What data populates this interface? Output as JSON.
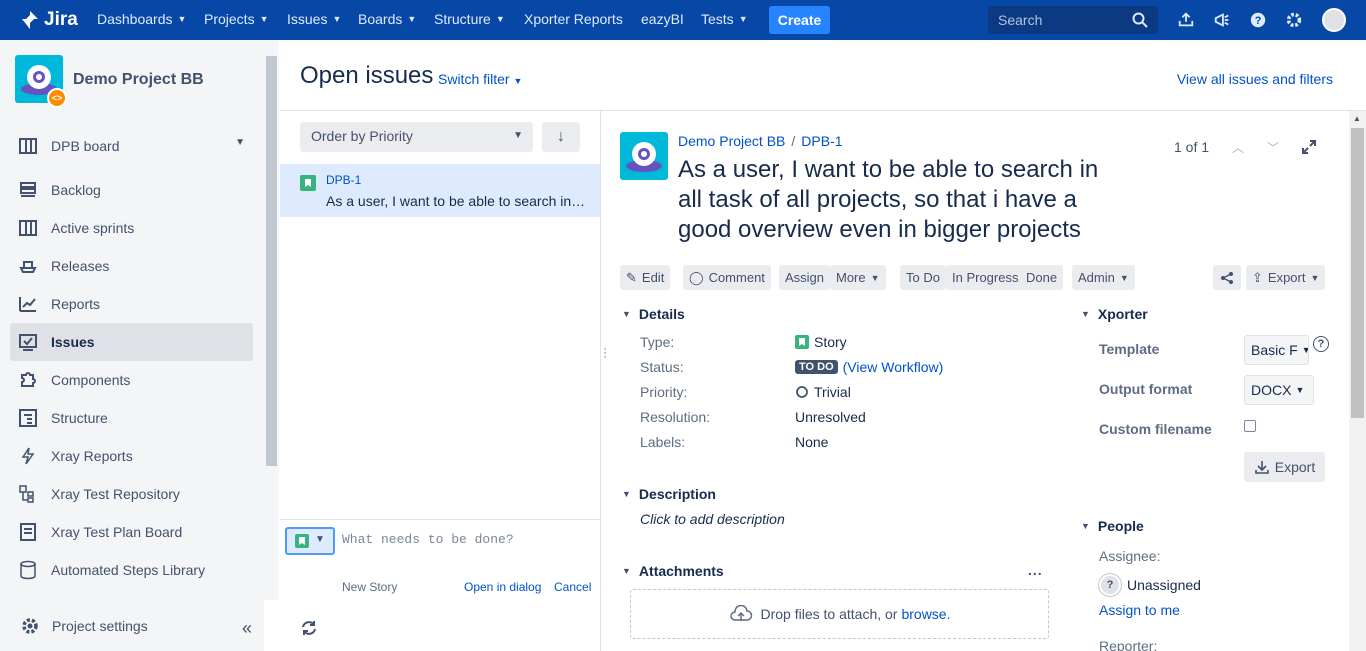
{
  "topnav": {
    "logo": "Jira",
    "items": [
      {
        "label": "Dashboards",
        "caret": true
      },
      {
        "label": "Projects",
        "caret": true
      },
      {
        "label": "Issues",
        "caret": true
      },
      {
        "label": "Boards",
        "caret": true
      },
      {
        "label": "Structure",
        "caret": true
      },
      {
        "label": "Xporter Reports",
        "caret": false
      },
      {
        "label": "eazyBI",
        "caret": false
      },
      {
        "label": "Tests",
        "caret": true
      }
    ],
    "create_label": "Create",
    "search_placeholder": "Search",
    "icons": [
      "upload-icon",
      "megaphone-icon",
      "help-icon",
      "gear-icon",
      "avatar"
    ]
  },
  "sidebar": {
    "project_name": "Demo Project BB",
    "board_label": "DPB board",
    "items": [
      {
        "label": "Backlog",
        "icon": "backlog-icon"
      },
      {
        "label": "Active sprints",
        "icon": "sprints-icon"
      },
      {
        "label": "Releases",
        "icon": "ship-icon"
      },
      {
        "label": "Reports",
        "icon": "chart-icon"
      },
      {
        "label": "Issues",
        "icon": "issues-icon",
        "active": true
      },
      {
        "label": "Components",
        "icon": "puzzle-icon"
      },
      {
        "label": "Structure",
        "icon": "structure-icon"
      },
      {
        "label": "Xray Reports",
        "icon": "lightning-icon"
      },
      {
        "label": "Xray Test Repository",
        "icon": "repository-icon"
      },
      {
        "label": "Xray Test Plan Board",
        "icon": "plan-board-icon"
      },
      {
        "label": "Automated Steps Library",
        "icon": "library-icon"
      }
    ],
    "settings_label": "Project settings"
  },
  "header": {
    "title": "Open issues",
    "switch_filter": "Switch filter",
    "view_all": "View all issues and filters"
  },
  "issue_list": {
    "order_label": "Order by Priority",
    "issues": [
      {
        "key": "DPB-1",
        "summary": "As a user, I want to be able to search in all task of all projects, so that i have a good overview even in bigger projects"
      }
    ],
    "new_placeholder": "What needs to be done?",
    "new_type": "New Story",
    "open_dialog": "Open in dialog",
    "cancel": "Cancel"
  },
  "detail": {
    "breadcrumb_project": "Demo Project BB",
    "breadcrumb_key": "DPB-1",
    "title": "As a user, I want to be able to search in all task of all projects, so that i have a good overview even in bigger projects",
    "pager": "1 of 1",
    "ops": {
      "edit": "Edit",
      "comment": "Comment",
      "assign": "Assign",
      "more": "More",
      "todo": "To Do",
      "in_progress": "In Progress",
      "done": "Done",
      "admin": "Admin",
      "export": "Export"
    },
    "details_heading": "Details",
    "fields": {
      "type_label": "Type:",
      "type_value": "Story",
      "status_label": "Status:",
      "status_value": "TO DO",
      "view_workflow": "(View Workflow)",
      "priority_label": "Priority:",
      "priority_value": "Trivial",
      "resolution_label": "Resolution:",
      "resolution_value": "Unresolved",
      "labels_label": "Labels:",
      "labels_value": "None"
    },
    "description_heading": "Description",
    "description_placeholder": "Click to add description",
    "attachments_heading": "Attachments",
    "attachments_more": "...",
    "dropzone_text": "Drop files to attach, or",
    "dropzone_link": "browse."
  },
  "xporter": {
    "heading": "Xporter",
    "template_label": "Template",
    "template_value": "Basic F",
    "output_label": "Output format",
    "output_value": "DOCX",
    "filename_label": "Custom filename",
    "export_label": "Export"
  },
  "people": {
    "heading": "People",
    "assignee_label": "Assignee:",
    "assignee_value": "Unassigned",
    "assign_to_me": "Assign to me",
    "reporter_label": "Reporter:"
  }
}
